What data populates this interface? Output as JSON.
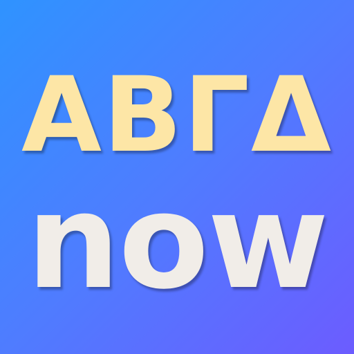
{
  "logo": {
    "top_text": "ΑΒΓΔ",
    "bottom_text": "now",
    "colors": {
      "background_start": "#2f93ff",
      "background_end": "#6c5cff",
      "top_text": "#fde6a6",
      "bottom_text": "#f1ede8"
    }
  }
}
